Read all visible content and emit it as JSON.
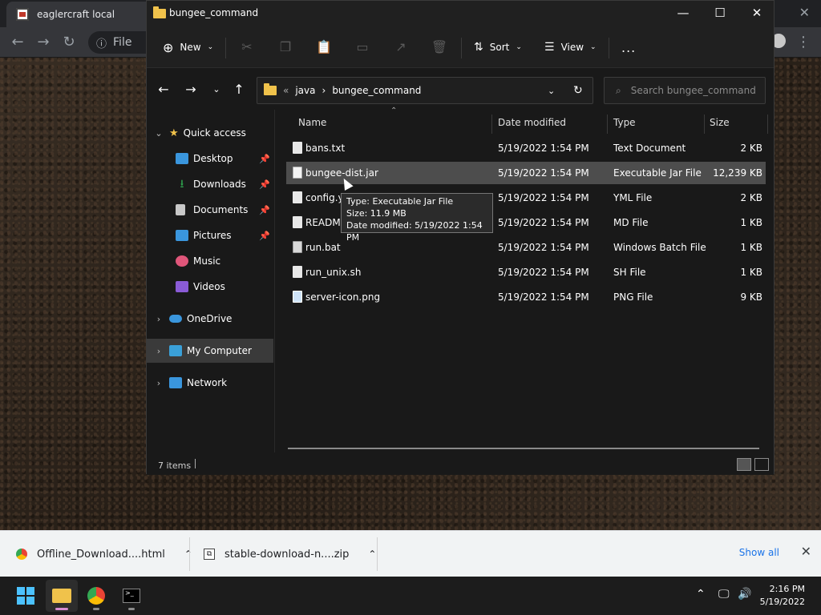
{
  "chrome": {
    "tab_title": "eaglercraft local",
    "omnibox_label": "File"
  },
  "explorer": {
    "title": "bungee_command",
    "toolbar": {
      "new_label": "New",
      "sort_label": "Sort",
      "view_label": "View",
      "more_label": "..."
    },
    "address": {
      "overflow": "«",
      "crumbs": [
        "java",
        "bungee_command"
      ]
    },
    "search_placeholder": "Search bungee_command",
    "sidebar": {
      "quick_access": "Quick access",
      "items": [
        {
          "label": "Desktop",
          "icon": "desktop-icon",
          "color": "#3a96dd",
          "pinned": true
        },
        {
          "label": "Downloads",
          "icon": "download-icon",
          "color": "#2fa84f",
          "pinned": true
        },
        {
          "label": "Documents",
          "icon": "documents-icon",
          "color": "#c8c8c8",
          "pinned": true
        },
        {
          "label": "Pictures",
          "icon": "pictures-icon",
          "color": "#3a96dd",
          "pinned": true
        },
        {
          "label": "Music",
          "icon": "music-icon",
          "color": "#e0567a",
          "pinned": false
        },
        {
          "label": "Videos",
          "icon": "videos-icon",
          "color": "#8a5bd6",
          "pinned": false
        }
      ],
      "onedrive": "OneDrive",
      "my_computer": "My Computer",
      "network": "Network"
    },
    "columns": {
      "name": "Name",
      "date": "Date modified",
      "type": "Type",
      "size": "Size"
    },
    "files": [
      {
        "name": "bans.txt",
        "date": "5/19/2022 1:54 PM",
        "type": "Text Document",
        "size": "2 KB"
      },
      {
        "name": "bungee-dist.jar",
        "date": "5/19/2022 1:54 PM",
        "type": "Executable Jar File",
        "size": "12,239 KB"
      },
      {
        "name": "config.yml",
        "date": "5/19/2022 1:54 PM",
        "type": "YML File",
        "size": "2 KB"
      },
      {
        "name": "README.md",
        "date": "5/19/2022 1:54 PM",
        "type": "MD File",
        "size": "1 KB"
      },
      {
        "name": "run.bat",
        "date": "5/19/2022 1:54 PM",
        "type": "Windows Batch File",
        "size": "1 KB"
      },
      {
        "name": "run_unix.sh",
        "date": "5/19/2022 1:54 PM",
        "type": "SH File",
        "size": "1 KB"
      },
      {
        "name": "server-icon.png",
        "date": "5/19/2022 1:54 PM",
        "type": "PNG File",
        "size": "9 KB"
      }
    ],
    "tooltip": {
      "type_line": "Type: Executable Jar File",
      "size_line": "Size: 11.9 MB",
      "date_line": "Date modified: 5/19/2022 1:54 PM"
    },
    "status": "7 items"
  },
  "downloads": {
    "items": [
      {
        "name": "Offline_Download....html",
        "icon": "chrome-icon"
      },
      {
        "name": "stable-download-n....zip",
        "icon": "zip-icon"
      }
    ],
    "show_all": "Show all"
  },
  "taskbar": {
    "time": "2:16 PM",
    "date": "5/19/2022"
  }
}
